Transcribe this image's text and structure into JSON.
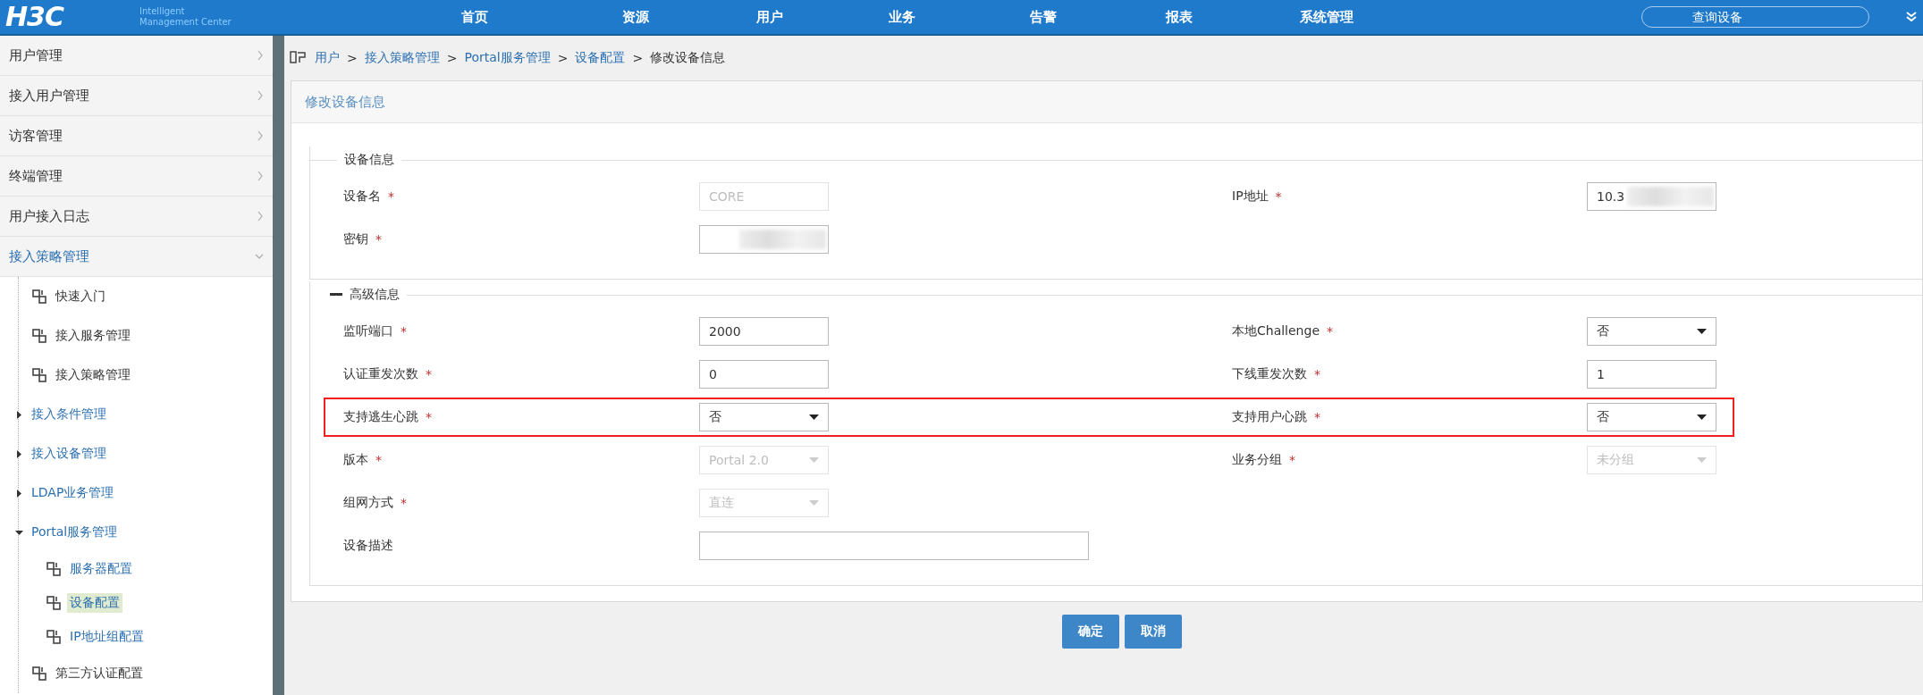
{
  "header": {
    "logo": "H3C",
    "logo_line1": "Intelligent",
    "logo_line2": "Management Center",
    "nav": [
      "首页",
      "资源",
      "用户",
      "业务",
      "告警",
      "报表",
      "系统管理"
    ],
    "search": {
      "placeholder": "查询设备"
    }
  },
  "sidebar": {
    "menu": [
      {
        "label": "用户管理",
        "expanded": false
      },
      {
        "label": "接入用户管理",
        "expanded": false
      },
      {
        "label": "访客管理",
        "expanded": false
      },
      {
        "label": "终端管理",
        "expanded": false
      },
      {
        "label": "用户接入日志",
        "expanded": false
      },
      {
        "label": "接入策略管理",
        "expanded": true,
        "children": [
          {
            "kind": "leaf",
            "label": "快速入门",
            "selected": false
          },
          {
            "kind": "leaf",
            "label": "接入服务管理",
            "selected": false
          },
          {
            "kind": "leaf",
            "label": "接入策略管理",
            "selected": false
          },
          {
            "kind": "group",
            "label": "接入条件管理",
            "expanded": false
          },
          {
            "kind": "group",
            "label": "接入设备管理",
            "expanded": false
          },
          {
            "kind": "group",
            "label": "LDAP业务管理",
            "expanded": false
          },
          {
            "kind": "group",
            "label": "Portal服务管理",
            "expanded": true,
            "children": [
              {
                "kind": "leaf",
                "label": "服务器配置",
                "selected": false
              },
              {
                "kind": "leaf",
                "label": "设备配置",
                "selected": true
              },
              {
                "kind": "leaf",
                "label": "IP地址组配置",
                "selected": false
              }
            ]
          },
          {
            "kind": "leaf",
            "label": "第三方认证配置",
            "selected": false
          }
        ]
      }
    ]
  },
  "breadcrumb": {
    "separator": ">",
    "items": [
      "用户",
      "接入策略管理",
      "Portal服务管理",
      "设备配置",
      "修改设备信息"
    ]
  },
  "panel": {
    "title": "修改设备信息",
    "sections": [
      {
        "title": "设备信息",
        "rows": [
          {
            "cells": [
              {
                "label": "设备名",
                "required_mark": "*",
                "field": {
                  "kind": "text",
                  "value": "CORE",
                  "disabled": true
                }
              },
              {
                "label": "IP地址",
                "required_mark": "*",
                "field": {
                  "kind": "text",
                  "value": "10.3",
                  "disabled": false,
                  "redacted": true
                }
              }
            ]
          },
          {
            "cells": [
              {
                "label": "密钥",
                "required_mark": "*",
                "field": {
                  "kind": "text",
                  "disabled": false,
                  "redacted": true
                }
              }
            ]
          }
        ]
      },
      {
        "title": "高级信息",
        "collapsible": true,
        "rows": [
          {
            "cells": [
              {
                "label": "监听端口",
                "required_mark": "*",
                "field": {
                  "kind": "text",
                  "value": "2000",
                  "disabled": false
                }
              },
              {
                "label": "本地Challenge",
                "required_mark": "*",
                "field": {
                  "kind": "select",
                  "value": "否",
                  "disabled": false
                }
              }
            ]
          },
          {
            "cells": [
              {
                "label": "认证重发次数",
                "required_mark": "*",
                "field": {
                  "kind": "text",
                  "value": "0",
                  "disabled": false
                }
              },
              {
                "label": "下线重发次数",
                "required_mark": "*",
                "field": {
                  "kind": "text",
                  "value": "1",
                  "disabled": false
                }
              }
            ]
          },
          {
            "highlighted": true,
            "cells": [
              {
                "label": "支持逃生心跳",
                "required_mark": "*",
                "field": {
                  "kind": "select",
                  "value": "否",
                  "disabled": false
                }
              },
              {
                "label": "支持用户心跳",
                "required_mark": "*",
                "field": {
                  "kind": "select",
                  "value": "否",
                  "disabled": false
                }
              }
            ]
          },
          {
            "cells": [
              {
                "label": "版本",
                "required_mark": "*",
                "field": {
                  "kind": "select",
                  "value": "Portal 2.0",
                  "disabled": true
                }
              },
              {
                "label": "业务分组",
                "required_mark": "*",
                "field": {
                  "kind": "select",
                  "value": "未分组",
                  "disabled": true
                }
              }
            ]
          },
          {
            "cells": [
              {
                "label": "组网方式",
                "required_mark": "*",
                "field": {
                  "kind": "select",
                  "value": "直连",
                  "disabled": true
                }
              }
            ]
          },
          {
            "cells": [
              {
                "label": "设备描述",
                "field": {
                  "kind": "textarea",
                  "disabled": false
                }
              }
            ]
          }
        ]
      }
    ]
  },
  "buttons": [
    "确定",
    "取消"
  ]
}
